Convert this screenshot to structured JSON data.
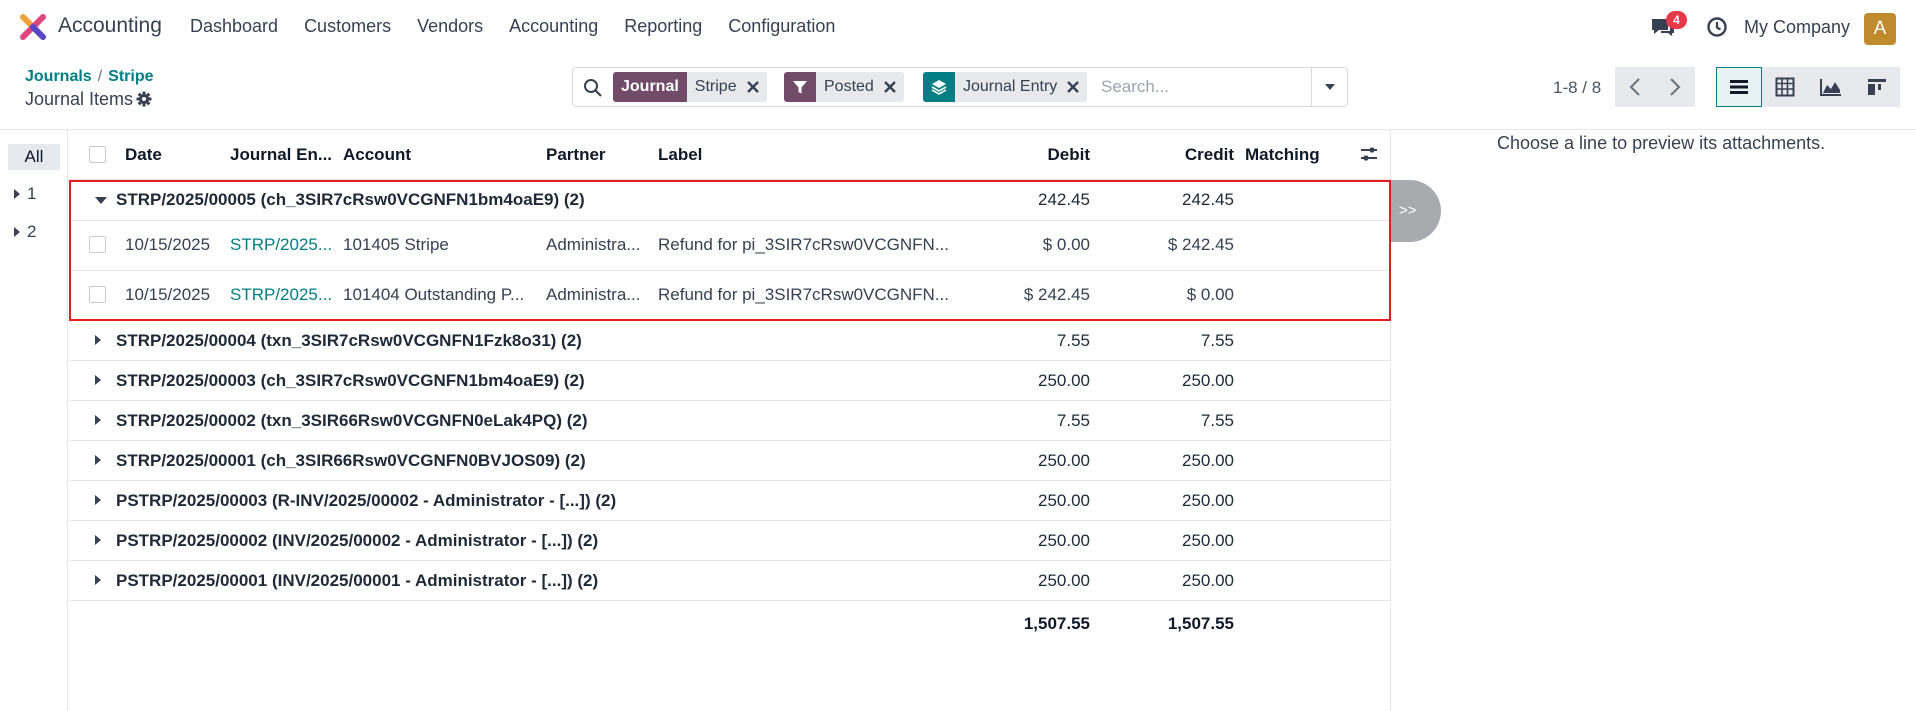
{
  "app": {
    "name": "Accounting"
  },
  "menu": [
    "Dashboard",
    "Customers",
    "Vendors",
    "Accounting",
    "Reporting",
    "Configuration"
  ],
  "systray": {
    "chat_badge": "4",
    "company": "My Company",
    "avatar_letter": "A"
  },
  "breadcrumb": {
    "parent": "Journals",
    "current": "Stripe",
    "sep": "/"
  },
  "page_title": "Journal Items",
  "search": {
    "facets": [
      {
        "label": "Journal",
        "value": "Stripe",
        "color": "#714b67"
      },
      {
        "label": "",
        "value": "Posted",
        "color": "#714b67"
      },
      {
        "label": "",
        "value": "Journal Entry",
        "color": "#017e84"
      }
    ],
    "placeholder": "Search..."
  },
  "pager": "1-8 / 8",
  "side_panel": {
    "all": "All",
    "items": [
      "1",
      "2"
    ]
  },
  "columns": {
    "date": "Date",
    "journal_entry": "Journal En...",
    "account": "Account",
    "partner": "Partner",
    "label": "Label",
    "debit": "Debit",
    "credit": "Credit",
    "matching": "Matching"
  },
  "groups": [
    {
      "title": "STRP/2025/00005 (ch_3SIR7cRsw0VCGNFN1bm4oaE9) (2)",
      "debit": "242.45",
      "credit": "242.45",
      "expanded": true
    },
    {
      "title": "STRP/2025/00004 (txn_3SIR7cRsw0VCGNFN1Fzk8o31) (2)",
      "debit": "7.55",
      "credit": "7.55"
    },
    {
      "title": "STRP/2025/00003 (ch_3SIR7cRsw0VCGNFN1bm4oaE9) (2)",
      "debit": "250.00",
      "credit": "250.00"
    },
    {
      "title": "STRP/2025/00002 (txn_3SIR66Rsw0VCGNFN0eLak4PQ) (2)",
      "debit": "7.55",
      "credit": "7.55"
    },
    {
      "title": "STRP/2025/00001 (ch_3SIR66Rsw0VCGNFN0BVJOS09) (2)",
      "debit": "250.00",
      "credit": "250.00"
    },
    {
      "title": "PSTRP/2025/00003 (R-INV/2025/00002 - Administrator - [...]) (2)",
      "debit": "250.00",
      "credit": "250.00"
    },
    {
      "title": "PSTRP/2025/00002 (INV/2025/00002 - Administrator - [...]) (2)",
      "debit": "250.00",
      "credit": "250.00"
    },
    {
      "title": "PSTRP/2025/00001 (INV/2025/00001 - Administrator - [...]) (2)",
      "debit": "250.00",
      "credit": "250.00"
    }
  ],
  "lines": [
    {
      "date": "10/15/2025",
      "entry": "STRP/2025...",
      "account": "101405 Stripe",
      "partner": "Administra...",
      "label": "Refund for pi_3SIR7cRsw0VCGNFN...",
      "debit": "$ 0.00",
      "credit": "$ 242.45"
    },
    {
      "date": "10/15/2025",
      "entry": "STRP/2025...",
      "account": "101404 Outstanding P...",
      "partner": "Administra...",
      "label": "Refund for pi_3SIR7cRsw0VCGNFN...",
      "debit": "$ 242.45",
      "credit": "$ 0.00"
    }
  ],
  "totals": {
    "debit": "1,507.55",
    "credit": "1,507.55"
  },
  "preview": {
    "message": "Choose a line to preview its attachments.",
    "expand_label": ">>"
  }
}
